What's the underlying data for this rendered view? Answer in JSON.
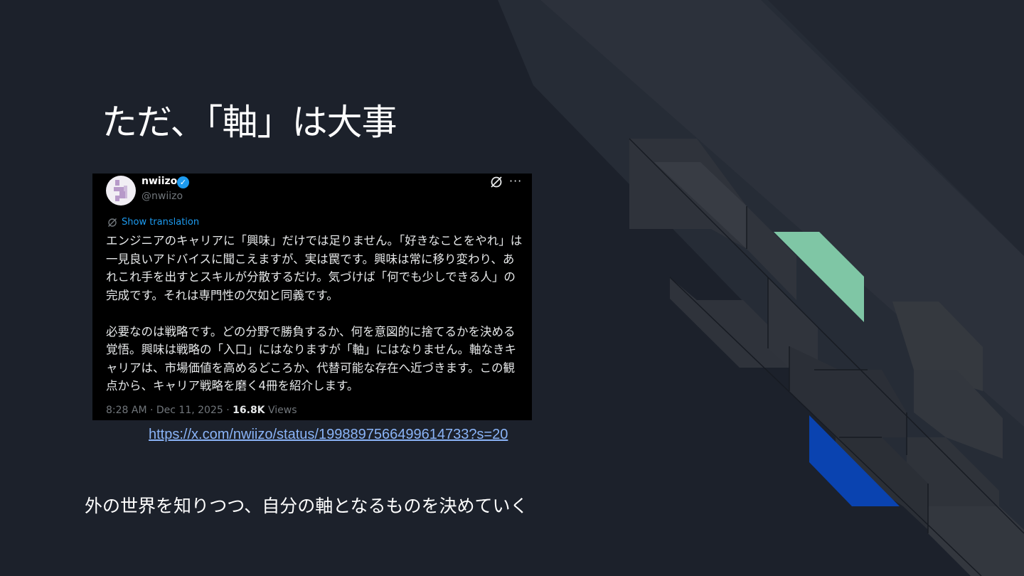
{
  "slide": {
    "title": "ただ、「軸」は大事",
    "link": "https://x.com/nwiizo/status/1998897566499614733?s=20",
    "caption": "外の世界を知りつつ、自分の軸となるものを決めていく"
  },
  "tweet": {
    "name": "nwiizo",
    "handle": "@nwiizo",
    "translate_label": "Show translation",
    "paragraph_1": "エンジニアのキャリアに「興味」だけでは足りません。「好きなことをやれ」は一見良いアドバイスに聞こえますが、実は罠です。興味は常に移り変わり、あれこれ手を出すとスキルが分散するだけ。気づけば「何でも少しできる人」の完成です。それは専門性の欠如と同義です。",
    "paragraph_2": "必要なのは戦略です。どの分野で勝負するか、何を意図的に捨てるかを決める覚悟。興味は戦略の「入口」にはなりますが「軸」にはなりません。軸なきキャリアは、市場価値を高めるどころか、代替可能な存在へ近づきます。この観点から、キャリア戦略を磨く4冊を紹介します。",
    "timestamp": "8:28 AM · Dec 11, 2025 · ",
    "views_count": "16.8K",
    "views_label": " Views"
  },
  "icons": {
    "verified": "verified-badge-icon",
    "grok": "grok-icon",
    "more": "more-icon",
    "translate": "translate-icon"
  },
  "colors": {
    "background": "#1c212b",
    "accent_green": "#7fc6a5",
    "accent_blue": "#0a43b0",
    "link": "#8ab4f8",
    "twitter_blue": "#1d9bf0"
  }
}
